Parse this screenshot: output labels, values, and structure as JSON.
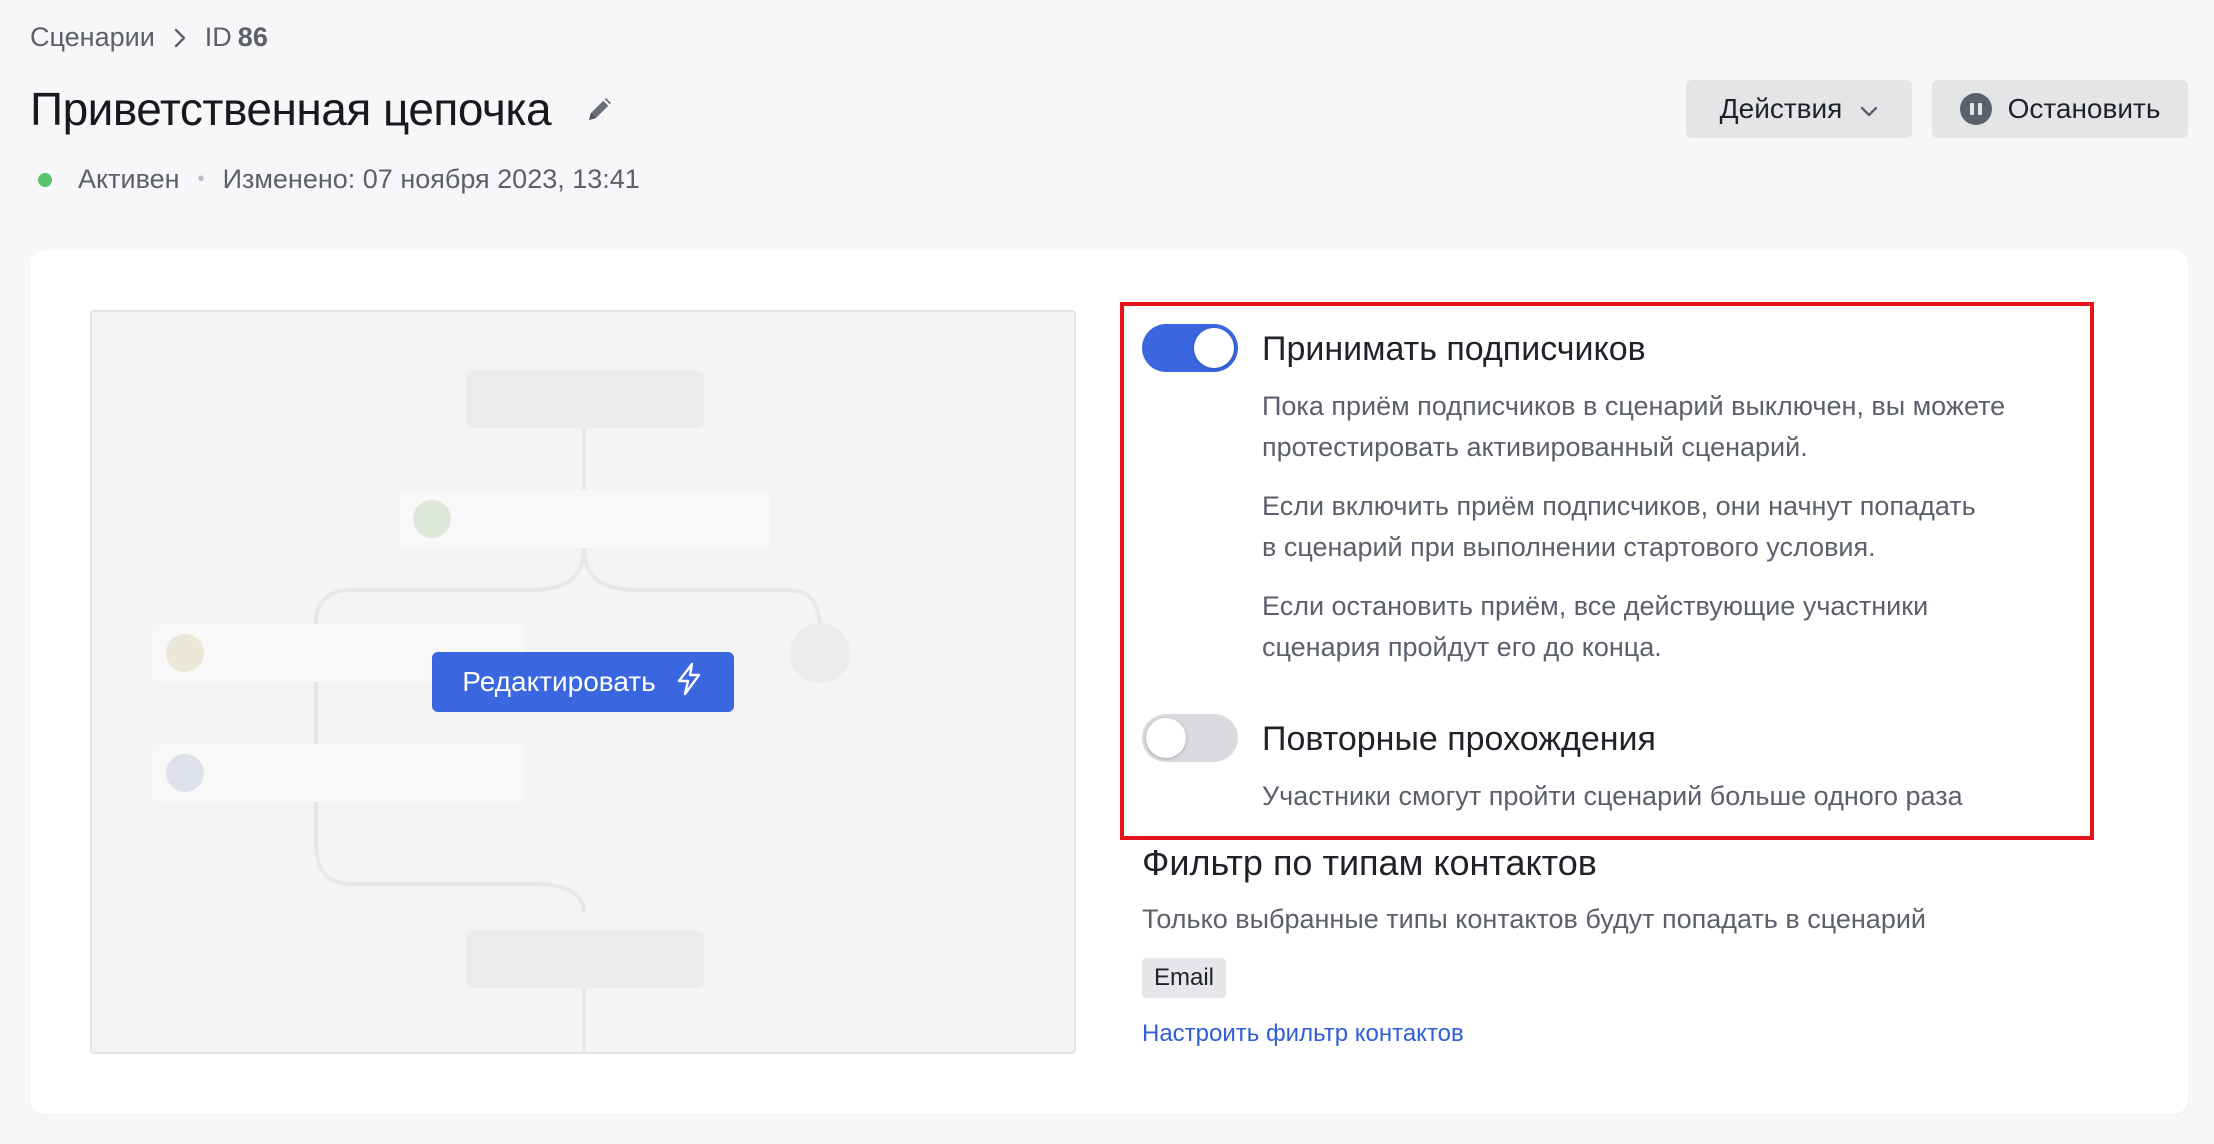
{
  "breadcrumb": {
    "parent": "Сценарии",
    "id_label": "ID",
    "id_value": "86"
  },
  "header": {
    "title": "Приветственная цепочка",
    "status": "Активен",
    "modified": "Изменено: 07 ноября 2023, 13:41",
    "actions_label": "Действия",
    "stop_label": "Остановить"
  },
  "preview": {
    "edit_label": "Редактировать"
  },
  "settings": {
    "accept": {
      "title": "Принимать подписчиков",
      "enabled": true,
      "desc1_line1": "Пока приём подписчиков в сценарий выключен, вы можете",
      "desc1_line2": "протестировать активированный сценарий.",
      "desc2_line1": "Если включить приём подписчиков, они начнут попадать",
      "desc2_line2": "в сценарий при выполнении стартового условия.",
      "desc3_line1": "Если остановить приём, все действующие участники",
      "desc3_line2": "сценария пройдут его до конца."
    },
    "repeat": {
      "title": "Повторные прохождения",
      "enabled": false,
      "desc": "Участники смогут пройти сценарий больше одного раза"
    }
  },
  "filter": {
    "title": "Фильтр по типам контактов",
    "desc": "Только выбранные типы контактов будут попадать в сценарий",
    "chips": [
      "Email"
    ],
    "link": "Настроить фильтр контактов"
  },
  "colors": {
    "accent": "#3a66e0",
    "status_active": "#5ac46e",
    "highlight": "#e5141c"
  }
}
